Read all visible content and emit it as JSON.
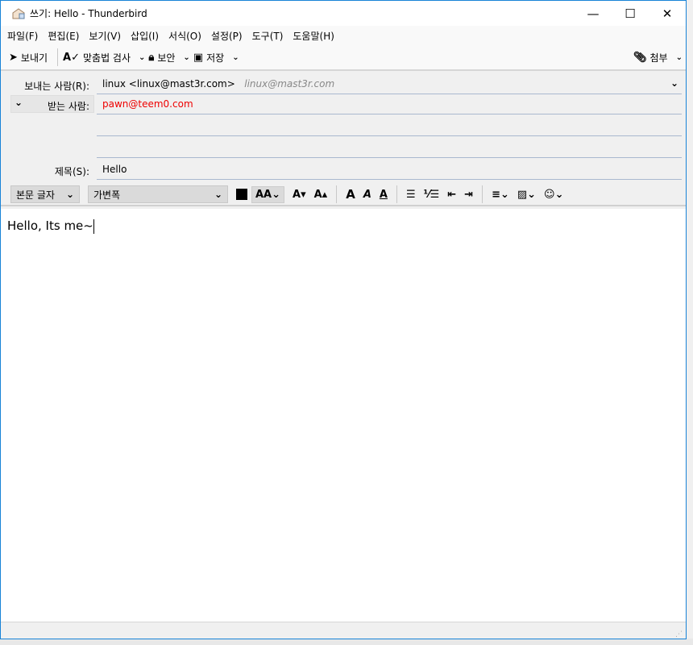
{
  "window": {
    "title": "쓰기: Hello - Thunderbird",
    "minimize": "—",
    "maximize": "☐",
    "close": "✕"
  },
  "menu": [
    "파일(F)",
    "편집(E)",
    "보기(V)",
    "삽입(I)",
    "서식(O)",
    "설정(P)",
    "도구(T)",
    "도움말(H)"
  ],
  "toolbar": {
    "send": "보내기",
    "spell": "맞춤법 검사",
    "security": "보안",
    "save": "저장",
    "attach": "첨부"
  },
  "header": {
    "from_label": "보내는 사람(R):",
    "from_value": "linux <linux@mast3r.com>",
    "from_identity": "linux@mast3r.com",
    "to_label": "받는 사람:",
    "to_value": "pawn@teem0.com",
    "to_color": "#ee0000",
    "subject_label": "제목(S):",
    "subject_value": "Hello"
  },
  "format": {
    "paragraph": "본문 글자",
    "font": "가변폭"
  },
  "body": {
    "text": "Hello, Its me~"
  }
}
